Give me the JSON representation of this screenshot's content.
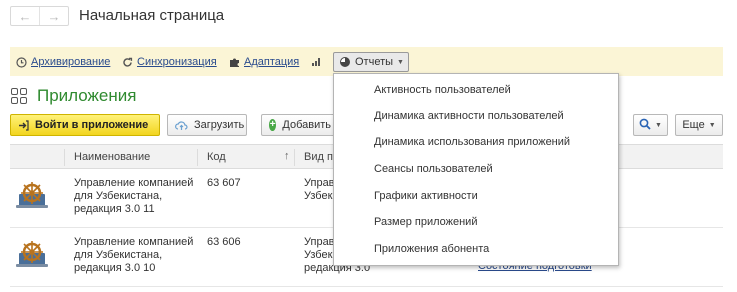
{
  "header": {
    "title": "Начальная страница",
    "back_icon": "arrow-left-icon",
    "forward_icon": "arrow-right-icon",
    "favorite_icon": "star-icon"
  },
  "commands": {
    "archive": "Архивирование",
    "sync": "Синхронизация",
    "adapt": "Адаптация",
    "reports": "Отчеты"
  },
  "section": {
    "title": "Приложения"
  },
  "toolbar": {
    "enter": "Войти в приложение",
    "upload": "Загрузить",
    "add": "Добавить",
    "more": "Еще"
  },
  "table": {
    "columns": [
      "Наименование",
      "Код",
      "Вид п"
    ],
    "rows": [
      {
        "name": "Управление компанией для Узбекистана, редакция 3.0 11",
        "code": "63 607",
        "type": "Управ компа Узбек редак"
      },
      {
        "name": "Управление компанией для Узбекистана, редакция 3.0 10",
        "code": "63 606",
        "type": "Управ компа Узбекистана, редакция 3.0",
        "link": "Состояние подготовки"
      }
    ]
  },
  "reports_menu": [
    "Активность пользователей",
    "Динамика активности пользователей",
    "Динамика использования приложений",
    "Сеансы пользователей",
    "Графики активности",
    "Размер приложений",
    "Приложения абонента"
  ],
  "colors": {
    "accent_green": "#2f8a2f",
    "command_bar": "#fbf5d6",
    "primary_button": "#f2d51f",
    "link": "#2a4b8d"
  }
}
